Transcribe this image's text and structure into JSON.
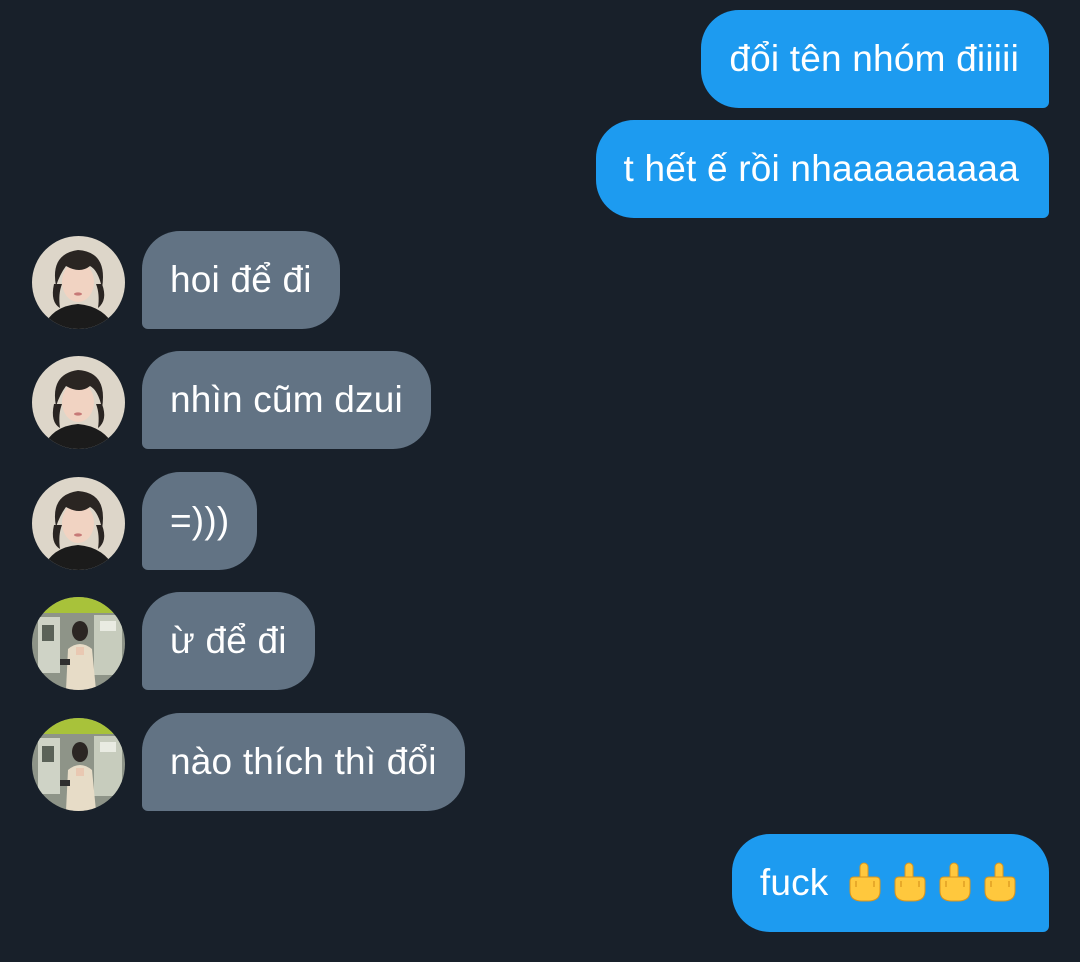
{
  "messages": [
    {
      "direction": "out",
      "text": "đổi tên nhóm điiiii"
    },
    {
      "direction": "out",
      "text": "t hết ế rồi nhaaaaaaaaa"
    },
    {
      "direction": "in",
      "sender_avatar": "avatar-person-a",
      "text": "hoi để đi"
    },
    {
      "direction": "in",
      "sender_avatar": "avatar-person-a",
      "text": "nhìn cũm dzui"
    },
    {
      "direction": "in",
      "sender_avatar": "avatar-person-a",
      "text": "=)))"
    },
    {
      "direction": "in",
      "sender_avatar": "avatar-person-b",
      "text": "ừ để đi"
    },
    {
      "direction": "in",
      "sender_avatar": "avatar-person-b",
      "text": "nào thích thì đổi"
    },
    {
      "direction": "out",
      "text": "fuck",
      "emoji": [
        "middle-finger-emoji",
        "middle-finger-emoji",
        "middle-finger-emoji",
        "middle-finger-emoji"
      ]
    }
  ],
  "colors": {
    "background": "#18202a",
    "outgoing_bubble": "#1d9bf0",
    "incoming_bubble": "#627384",
    "text": "#ffffff",
    "emoji_yellow": "#ffc83d"
  }
}
